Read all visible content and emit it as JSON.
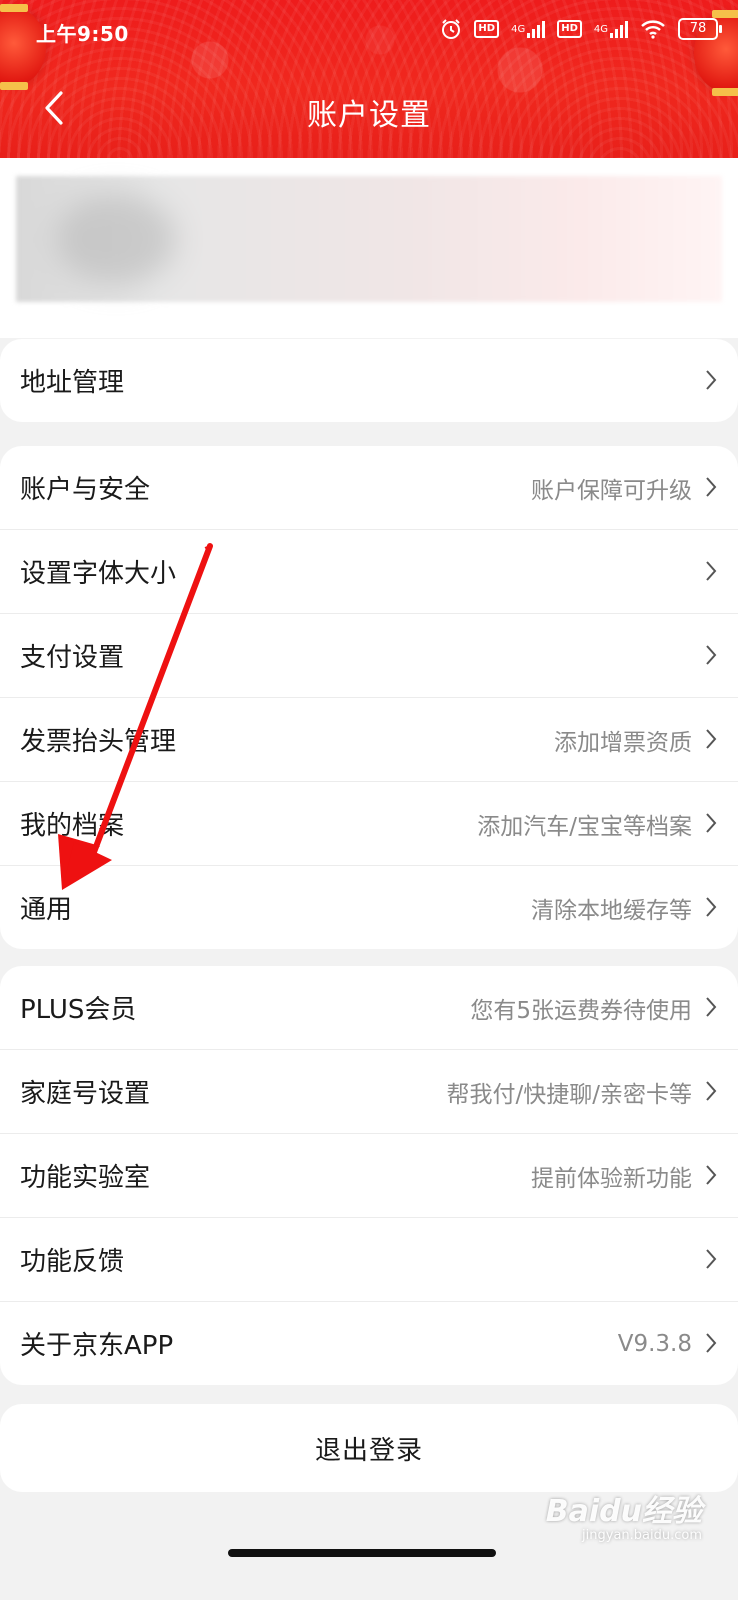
{
  "status_bar": {
    "time": "上午9:50",
    "network_label": "4G",
    "hd_label": "HD",
    "battery": "78"
  },
  "header": {
    "title": "账户设置"
  },
  "groups": [
    [
      {
        "label": "地址管理",
        "value": ""
      }
    ],
    [
      {
        "label": "账户与安全",
        "value": "账户保障可升级"
      },
      {
        "label": "设置字体大小",
        "value": ""
      },
      {
        "label": "支付设置",
        "value": ""
      },
      {
        "label": "发票抬头管理",
        "value": "添加增票资质"
      },
      {
        "label": "我的档案",
        "value": "添加汽车/宝宝等档案"
      },
      {
        "label": "通用",
        "value": "清除本地缓存等"
      }
    ],
    [
      {
        "label": "PLUS会员",
        "value": "您有5张运费券待使用"
      },
      {
        "label": "家庭号设置",
        "value": "帮我付/快捷聊/亲密卡等"
      },
      {
        "label": "功能实验室",
        "value": "提前体验新功能"
      },
      {
        "label": "功能反馈",
        "value": ""
      },
      {
        "label": "关于京东APP",
        "value": "V9.3.8"
      }
    ]
  ],
  "logout_label": "退出登录",
  "watermark": {
    "brand": "Baidu经验",
    "url": "jingyan.baidu.com"
  },
  "colors": {
    "header_red": "#ee1c1c",
    "annotation_arrow": "#ee1111",
    "secondary_text": "#8a8a8a"
  }
}
